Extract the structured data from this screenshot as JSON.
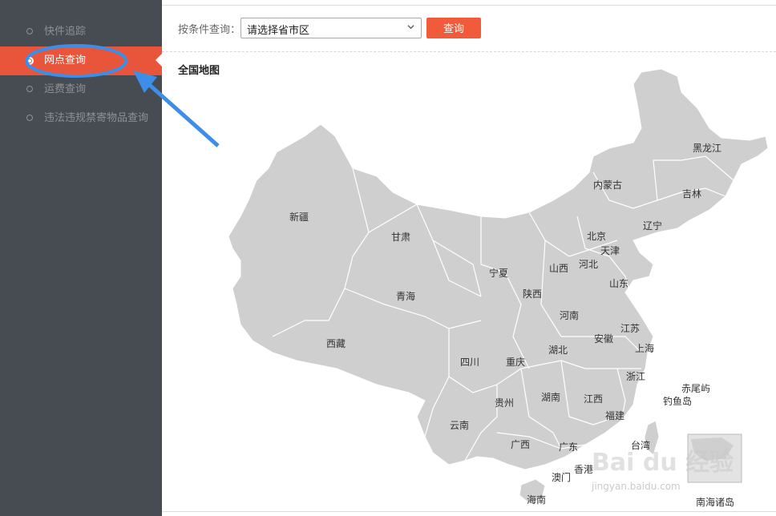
{
  "sidebar": {
    "items": [
      {
        "label": "快件追踪"
      },
      {
        "label": "网点查询"
      },
      {
        "label": "运费查询"
      },
      {
        "label": "违法违规禁寄物品查询"
      }
    ]
  },
  "filter": {
    "label": "按条件查询：",
    "select_value": "请选择省市区",
    "button_label": "查询"
  },
  "map": {
    "title": "全国地图",
    "provinces": [
      "新疆",
      "甘肃",
      "青海",
      "西藏",
      "内蒙古",
      "黑龙江",
      "吉林",
      "辽宁",
      "北京",
      "天津",
      "河北",
      "山西",
      "宁夏",
      "陕西",
      "山东",
      "河南",
      "江苏",
      "安徽",
      "上海",
      "湖北",
      "四川",
      "重庆",
      "浙江",
      "贵州",
      "湖南",
      "江西",
      "云南",
      "福建",
      "广西",
      "广东",
      "台湾",
      "香港",
      "澳门",
      "海南",
      "南海诸岛",
      "赤尾屿",
      "钓鱼岛"
    ]
  },
  "watermark": {
    "brand": "Bai du 经验",
    "url": "jingyan.baidu.com"
  },
  "colors": {
    "sidebar_bg": "#474c52",
    "accent": "#e8553a",
    "button": "#f15a3a",
    "map_fill": "#cfcfcf",
    "annotation": "#3d8ee8"
  }
}
